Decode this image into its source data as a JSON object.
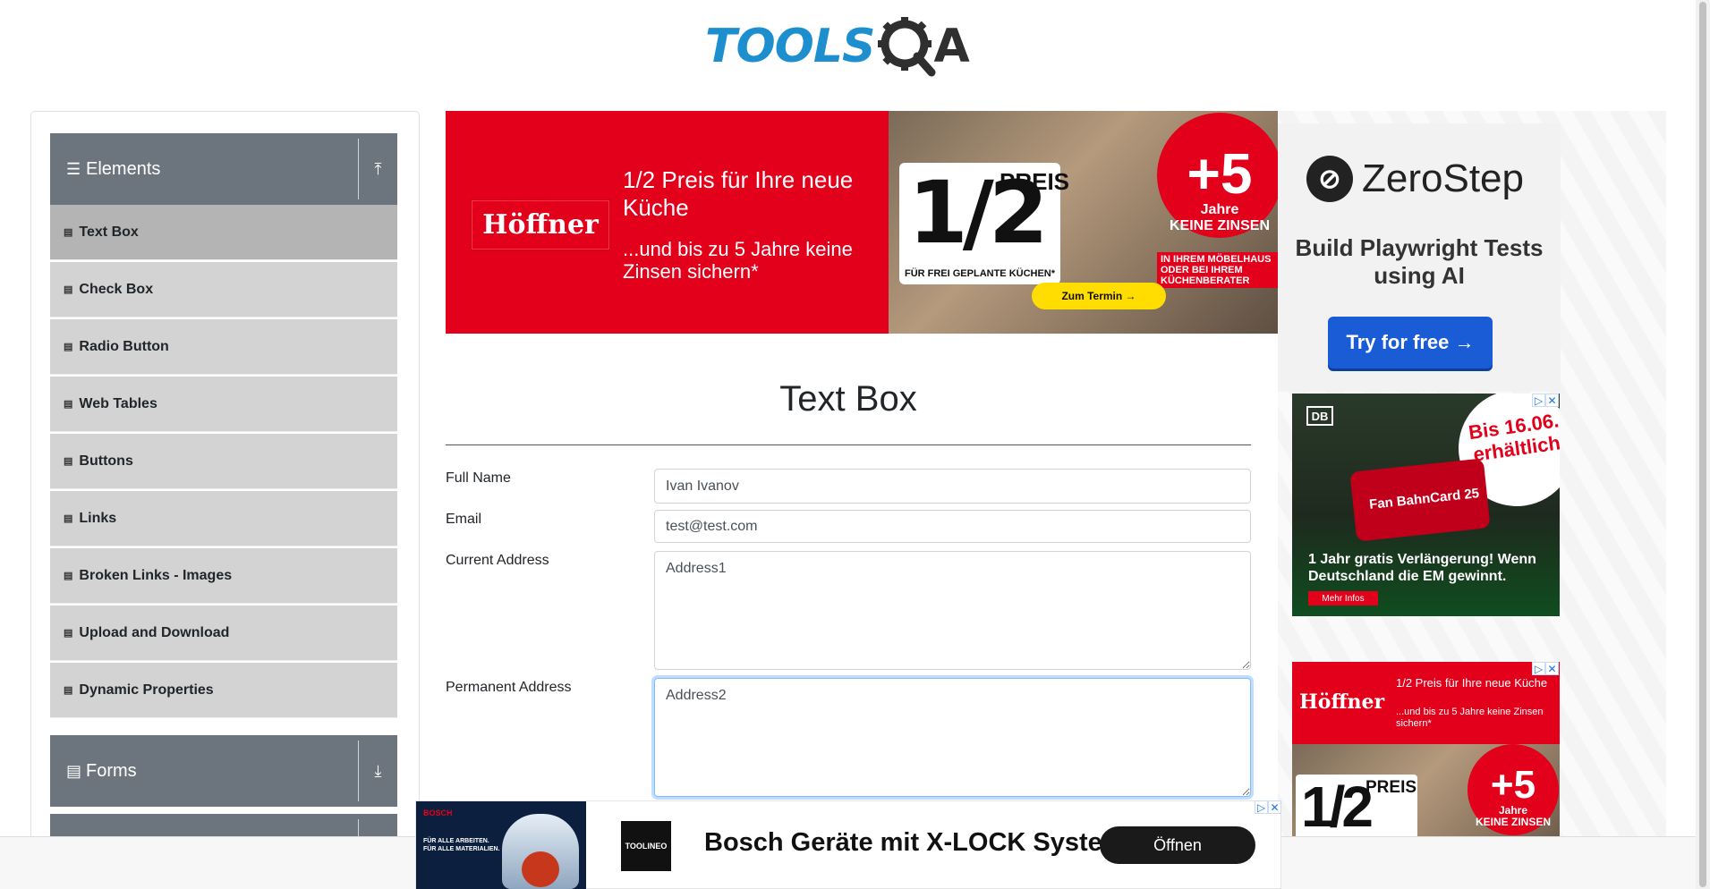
{
  "header": {
    "logo_text": "TOOLS",
    "logo_suffix": "A"
  },
  "sidebar": {
    "elements_group": {
      "label": "Elements"
    },
    "items": [
      {
        "label": "Text Box",
        "active": true
      },
      {
        "label": "Check Box"
      },
      {
        "label": "Radio Button"
      },
      {
        "label": "Web Tables"
      },
      {
        "label": "Buttons"
      },
      {
        "label": "Links"
      },
      {
        "label": "Broken Links - Images"
      },
      {
        "label": "Upload and Download"
      },
      {
        "label": "Dynamic Properties"
      }
    ],
    "forms_group": {
      "label": "Forms"
    }
  },
  "top_ad": {
    "brand": "Höffner",
    "headline": "1/2 Preis für Ihre neue Küche",
    "subline": "...und bis zu 5 Jahre keine Zinsen sichern*",
    "fraction": "1/2",
    "preis": "PREIS",
    "preis_footer": "FÜR FREI GEPLANTE KÜCHEN*",
    "zins_big": "+5",
    "zins_word": "Jahre",
    "zins_sub": "KEINE ZINSEN",
    "zins_bottom": "IN IHREM MÖBELHAUS ODER BEI IHREM KÜCHENBERATER",
    "termin_button": "Zum Termin →"
  },
  "main": {
    "title": "Text Box",
    "fields": {
      "full_name": {
        "label": "Full Name",
        "value": "Ivan Ivanov"
      },
      "email": {
        "label": "Email",
        "value": "test@test.com"
      },
      "current_address": {
        "label": "Current Address",
        "value": "Address1"
      },
      "permanent_address": {
        "label": "Permanent Address",
        "value": "Address2"
      }
    }
  },
  "right_ads": {
    "zerostep": {
      "name": "ZeroStep",
      "tagline": "Build Playwright Tests using AI",
      "button": "Try for free →"
    },
    "db": {
      "logo": "DB",
      "bubble": "Bis 16.06. erhältlich",
      "card": "Fan BahnCard 25",
      "text": "1 Jahr gratis Verlängerung! Wenn Deutschland die EM gewinnt.",
      "more": "Mehr Infos"
    },
    "hoeffner_small": {
      "brand": "Höffner",
      "headline": "1/2 Preis für Ihre neue Küche",
      "subline": "...und bis zu 5 Jahre keine Zinsen sichern*",
      "fraction": "1/2",
      "preis": "PREIS",
      "zins_big": "+5",
      "zins_word": "Jahre",
      "zins_sub": "KEINE ZINSEN"
    }
  },
  "bottom_ad": {
    "brand": "BOSCH",
    "img_text": "FÜR ALLE ARBEITEN. FÜR ALLE MATERIALIEN.",
    "sponsor": "TOOLINEO",
    "headline": "Bosch Geräte mit X-LOCK System",
    "button": "Öffnen"
  },
  "colors": {
    "sidebar_header": "#6c757d",
    "menu_item": "#d3d3d3",
    "menu_item_active": "#b4b4b4",
    "hoeffner_red": "#e2001a",
    "zerostep_blue": "#1a5cd6",
    "logo_blue": "#1d8fcf"
  }
}
